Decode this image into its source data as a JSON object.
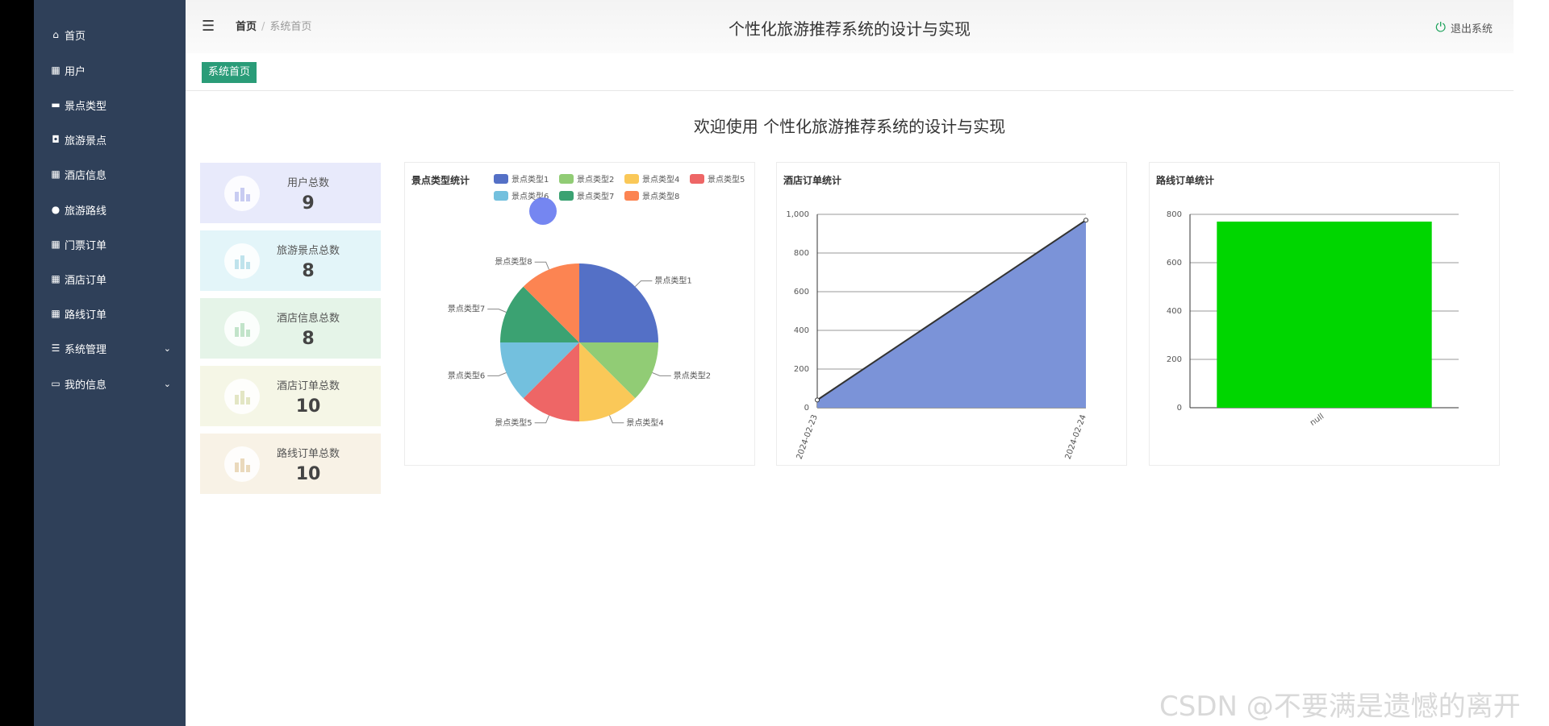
{
  "sidebar": {
    "items": [
      {
        "label": "首页",
        "icon": "home-icon"
      },
      {
        "label": "用户",
        "icon": "grid-icon"
      },
      {
        "label": "景点类型",
        "icon": "bookmark-icon"
      },
      {
        "label": "旅游景点",
        "icon": "camera-icon"
      },
      {
        "label": "酒店信息",
        "icon": "grid-icon"
      },
      {
        "label": "旅游路线",
        "icon": "person-icon"
      },
      {
        "label": "门票订单",
        "icon": "grid-icon"
      },
      {
        "label": "酒店订单",
        "icon": "grid-icon"
      },
      {
        "label": "路线订单",
        "icon": "grid-icon"
      },
      {
        "label": "系统管理",
        "icon": "sliders-icon",
        "expandable": true
      },
      {
        "label": "我的信息",
        "icon": "id-card-icon",
        "expandable": true
      }
    ]
  },
  "header": {
    "breadcrumb_home": "首页",
    "breadcrumb_sep": "/",
    "breadcrumb_current": "系统首页",
    "title": "个性化旅游推荐系统的设计与实现",
    "logout_label": "退出系统"
  },
  "tabs": [
    {
      "label": "系统首页",
      "active": true
    }
  ],
  "welcome": "欢迎使用 个性化旅游推荐系统的设计与实现",
  "stats": [
    {
      "label": "用户总数",
      "value": "9",
      "bg": "#e8eafb",
      "icon_color": "#c8ccf2"
    },
    {
      "label": "旅游景点总数",
      "value": "8",
      "bg": "#e3f5f9",
      "icon_color": "#bfe3ec"
    },
    {
      "label": "酒店信息总数",
      "value": "8",
      "bg": "#e5f4e8",
      "icon_color": "#c2e4ca"
    },
    {
      "label": "酒店订单总数",
      "value": "10",
      "bg": "#f5f6e6",
      "icon_color": "#e3e6c4"
    },
    {
      "label": "路线订单总数",
      "value": "10",
      "bg": "#f8f2e6",
      "icon_color": "#ead9bc"
    }
  ],
  "charts": {
    "pie": {
      "title": "景点类型统计"
    },
    "hotel": {
      "title": "酒店订单统计"
    },
    "route": {
      "title": "路线订单统计"
    }
  },
  "chart_data": [
    {
      "type": "pie",
      "title": "景点类型统计",
      "legend": [
        "景点类型1",
        "景点类型2",
        "景点类型4",
        "景点类型5",
        "景点类型6",
        "景点类型7",
        "景点类型8"
      ],
      "slices": [
        {
          "name": "景点类型1",
          "value": 2,
          "color": "#5470c6"
        },
        {
          "name": "景点类型2",
          "value": 1,
          "color": "#91cc75"
        },
        {
          "name": "景点类型4",
          "value": 1,
          "color": "#fac858"
        },
        {
          "name": "景点类型5",
          "value": 1,
          "color": "#ee6666"
        },
        {
          "name": "景点类型6",
          "value": 1,
          "color": "#73c0de"
        },
        {
          "name": "景点类型7",
          "value": 1,
          "color": "#3ba272"
        },
        {
          "name": "景点类型8",
          "value": 1,
          "color": "#fc8452"
        }
      ]
    },
    {
      "type": "area",
      "title": "酒店订单统计",
      "x": [
        "2024-02-23",
        "2024-02-24"
      ],
      "values": [
        40,
        970
      ],
      "ylim": [
        0,
        1000
      ],
      "yticks": [
        "0",
        "200",
        "400",
        "600",
        "800",
        "1,000"
      ],
      "color": "#7b93d8",
      "grid": true
    },
    {
      "type": "bar",
      "title": "路线订单统计",
      "categories": [
        "null"
      ],
      "values": [
        770
      ],
      "ylim": [
        0,
        800
      ],
      "yticks": [
        "0",
        "200",
        "400",
        "600",
        "800"
      ],
      "color": "#00d600",
      "grid": true
    }
  ],
  "watermark": "CSDN @不要满是遗憾的离开"
}
